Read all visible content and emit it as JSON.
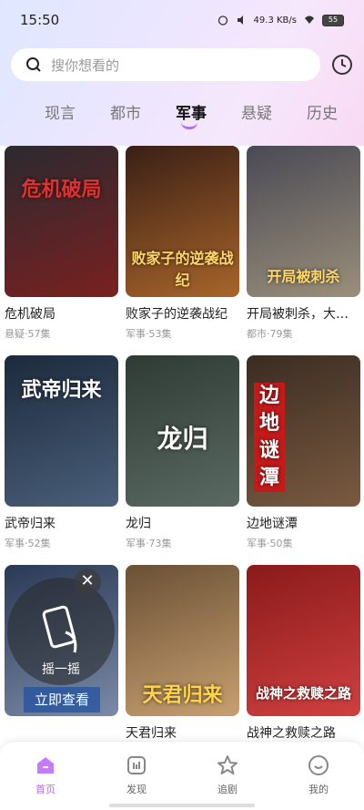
{
  "status": {
    "time": "15:50",
    "net": "49.3 KB/s",
    "battery": "55"
  },
  "search": {
    "placeholder": "搜你想看的"
  },
  "tabs": [
    "现言",
    "都市",
    "军事",
    "悬疑",
    "历史"
  ],
  "active_tab": "军事",
  "cards": [
    {
      "title": "危机破局",
      "meta": "悬疑·57集",
      "poster_text": "危机破局",
      "colors": [
        "#2b2a30",
        "#7a2020"
      ]
    },
    {
      "title": "败家子的逆袭战纪",
      "meta": "军事·53集",
      "poster_text": "败家子的逆袭战纪",
      "colors": [
        "#3a1f16",
        "#a8652a"
      ]
    },
    {
      "title": "开局被刺杀，大…",
      "meta": "都市·79集",
      "poster_text": "开局被刺杀",
      "colors": [
        "#4a4a55",
        "#9a8f7a"
      ]
    },
    {
      "title": "武帝归来",
      "meta": "军事·52集",
      "poster_text": "武帝归来",
      "colors": [
        "#1c2a3c",
        "#4a5f7a"
      ]
    },
    {
      "title": "龙归",
      "meta": "军事·73集",
      "poster_text": "龙归",
      "colors": [
        "#2f3a35",
        "#5a6a62"
      ]
    },
    {
      "title": "边地谜潭",
      "meta": "军事·50集",
      "poster_text": "边地谜潭",
      "colors": [
        "#3a2c22",
        "#7a5a40"
      ]
    },
    {
      "title": "",
      "meta": "",
      "poster_text": "",
      "colors": [
        "#2a3a55",
        "#7a8aa8"
      ]
    },
    {
      "title": "天君归来",
      "meta": "",
      "poster_text": "天君归来",
      "colors": [
        "#6a5035",
        "#c8a070"
      ]
    },
    {
      "title": "战神之救赎之路",
      "meta": "",
      "poster_text": "战神之救赎之路",
      "colors": [
        "#8a1a1a",
        "#d04040"
      ]
    }
  ],
  "shake": {
    "label": "摇一摇",
    "cta": "立即查看",
    "close": "✕"
  },
  "nav": [
    {
      "label": "首页",
      "icon": "home-icon"
    },
    {
      "label": "发现",
      "icon": "discover-icon"
    },
    {
      "label": "追剧",
      "icon": "star-icon"
    },
    {
      "label": "我的",
      "icon": "profile-icon"
    }
  ],
  "accent": "#b36bff"
}
